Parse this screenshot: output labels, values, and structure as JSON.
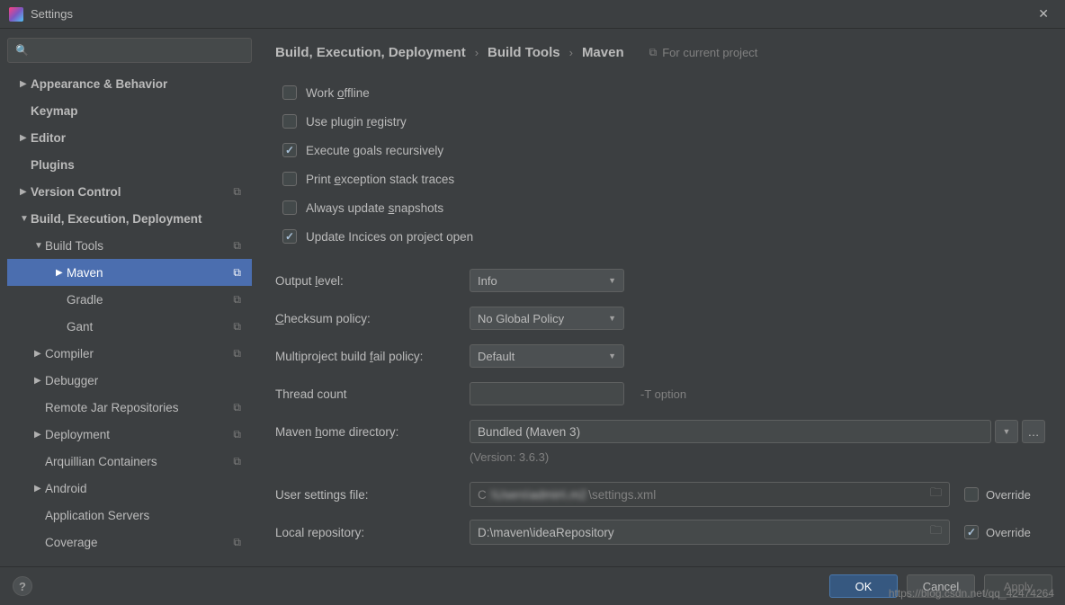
{
  "window": {
    "title": "Settings"
  },
  "sidebar": {
    "items": [
      {
        "label": "Appearance & Behavior",
        "arrow": "▶",
        "bold": true,
        "level": 0,
        "icon": ""
      },
      {
        "label": "Keymap",
        "arrow": "",
        "bold": true,
        "level": 0,
        "icon": ""
      },
      {
        "label": "Editor",
        "arrow": "▶",
        "bold": true,
        "level": 0,
        "icon": ""
      },
      {
        "label": "Plugins",
        "arrow": "",
        "bold": true,
        "level": 0,
        "icon": ""
      },
      {
        "label": "Version Control",
        "arrow": "▶",
        "bold": true,
        "level": 0,
        "icon": "⧉"
      },
      {
        "label": "Build, Execution, Deployment",
        "arrow": "▼",
        "bold": true,
        "level": 0,
        "icon": ""
      },
      {
        "label": "Build Tools",
        "arrow": "▼",
        "bold": false,
        "level": 1,
        "icon": "⧉"
      },
      {
        "label": "Maven",
        "arrow": "▶",
        "bold": false,
        "level": 2,
        "icon": "⧉",
        "selected": true
      },
      {
        "label": "Gradle",
        "arrow": "",
        "bold": false,
        "level": 2,
        "icon": "⧉"
      },
      {
        "label": "Gant",
        "arrow": "",
        "bold": false,
        "level": 2,
        "icon": "⧉"
      },
      {
        "label": "Compiler",
        "arrow": "▶",
        "bold": false,
        "level": 1,
        "icon": "⧉"
      },
      {
        "label": "Debugger",
        "arrow": "▶",
        "bold": false,
        "level": 1,
        "icon": ""
      },
      {
        "label": "Remote Jar Repositories",
        "arrow": "",
        "bold": false,
        "level": 1,
        "icon": "⧉"
      },
      {
        "label": "Deployment",
        "arrow": "▶",
        "bold": false,
        "level": 1,
        "icon": "⧉"
      },
      {
        "label": "Arquillian Containers",
        "arrow": "",
        "bold": false,
        "level": 1,
        "icon": "⧉"
      },
      {
        "label": "Android",
        "arrow": "▶",
        "bold": false,
        "level": 1,
        "icon": ""
      },
      {
        "label": "Application Servers",
        "arrow": "",
        "bold": false,
        "level": 1,
        "icon": ""
      },
      {
        "label": "Coverage",
        "arrow": "",
        "bold": false,
        "level": 1,
        "icon": "⧉"
      }
    ]
  },
  "breadcrumb": {
    "a": "Build, Execution, Deployment",
    "b": "Build Tools",
    "c": "Maven",
    "hint": "For current project"
  },
  "checkboxes": {
    "work_offline": {
      "label_pre": "Work ",
      "u": "o",
      "label_post": "ffline",
      "checked": false
    },
    "plugin_registry": {
      "label_pre": "Use plugin ",
      "u": "r",
      "label_post": "egistry",
      "checked": false
    },
    "execute_goals": {
      "label_pre": "Execute ",
      "u": "g",
      "label_post": "oals recursively",
      "checked": true
    },
    "print_exception": {
      "label_pre": "Print ",
      "u": "e",
      "label_post": "xception stack traces",
      "checked": false
    },
    "always_update": {
      "label_pre": "Always update ",
      "u": "s",
      "label_post": "napshots",
      "checked": false
    },
    "update_indices": {
      "label_pre": "Update Incices on project open",
      "u": "",
      "label_post": "",
      "checked": true
    }
  },
  "form": {
    "output_level": {
      "label_pre": "Output ",
      "u": "l",
      "label_post": "evel:",
      "value": "Info"
    },
    "checksum": {
      "label_pre": "",
      "u": "C",
      "label_post": "hecksum policy:",
      "value": "No Global Policy"
    },
    "multiproject": {
      "label_pre": "Multiproject build ",
      "u": "f",
      "label_post": "ail policy:",
      "value": "Default"
    },
    "thread_count": {
      "label": "Thread count",
      "aux": "-T option",
      "value": ""
    },
    "maven_home": {
      "label_pre": "Maven ",
      "u": "h",
      "label_post": "ome directory:",
      "value": "Bundled (Maven 3)"
    },
    "version": "(Version: 3.6.3)",
    "user_settings": {
      "label_pre": "User ",
      "u": "s",
      "label_post": "ettings file:",
      "value_prefix": "C",
      "value_suffix": "\\settings.xml",
      "override_label": "Override",
      "override": false
    },
    "local_repo": {
      "label_pre": "Local repositor",
      "u": "y",
      "label_post": ":",
      "value": "D:\\maven\\ideaRepository",
      "override_label": "Override",
      "override": true
    }
  },
  "buttons": {
    "ok": "OK",
    "cancel": "Cancel",
    "apply": "Apply"
  },
  "watermark": "https://blog.csdn.net/qq_42474264"
}
